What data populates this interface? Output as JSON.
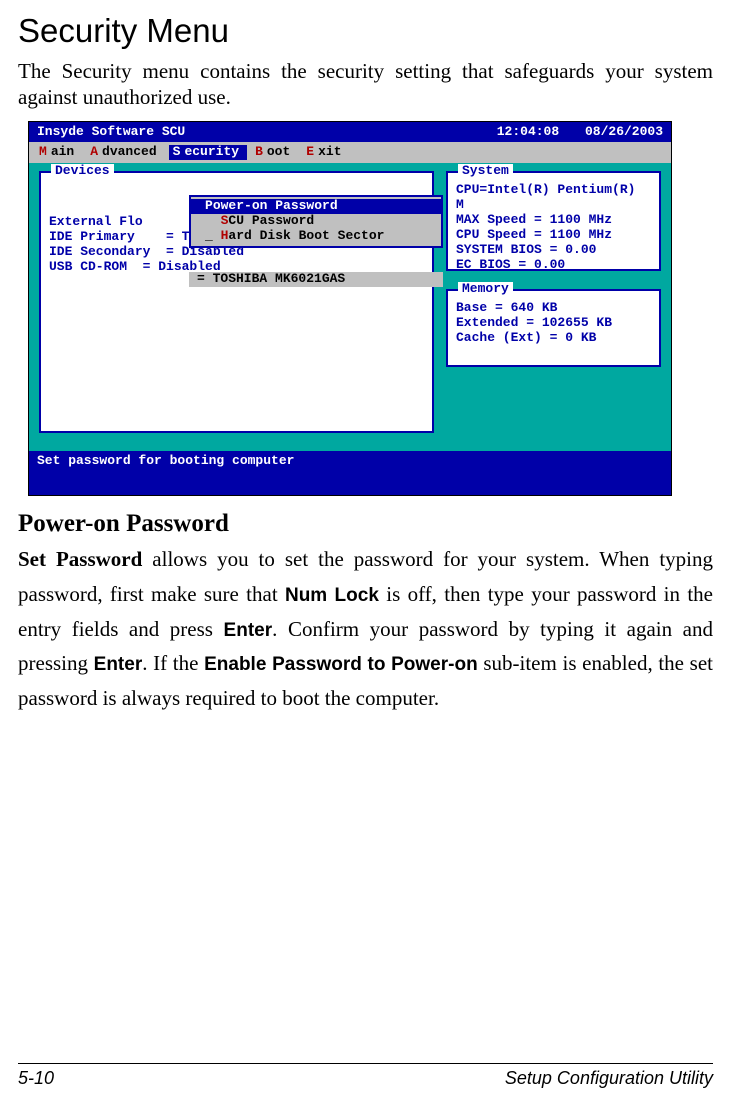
{
  "title": "Security Menu",
  "intro": "The Security menu contains the security setting that safeguards your system against unauthorized use.",
  "bios": {
    "brand": "Insyde Software SCU",
    "time": "12:04:08",
    "date": "08/26/2003",
    "menu": {
      "main": "ain",
      "advanced": "dvanced",
      "security": "ecurity",
      "boot": "oot",
      "exit": "xit"
    },
    "devices": {
      "title": "Devices",
      "lines": {
        "l1": "External Flo",
        "l2": "IDE Primary    = TOSHIBA MK6021GAS",
        "l3": "IDE Secondary  = Disabled",
        "l4": "USB CD-ROM  = Disabled"
      }
    },
    "dropdown": {
      "item1": "ower-on Password",
      "item2": "CU Password",
      "item3": "ard Disk Boot Sector",
      "overlay_row": "= TOSHIBA MK6021GAS"
    },
    "system": {
      "title": "System",
      "l1": "CPU=Intel(R) Pentium(R) M",
      "l2": "MAX   Speed = 1100 MHz",
      "l3": "CPU   Speed = 1100 MHz",
      "l4": "SYSTEM BIOS = 0.00",
      "l5": "EC     BIOS = 0.00"
    },
    "memory": {
      "title": "Memory",
      "l1": "Base         =    640 KB",
      "l2": "Extended     = 102655 KB",
      "l3": "Cache (Ext)  =      0 KB"
    },
    "help": "Set password for booting computer"
  },
  "section": {
    "heading": "Power-on Password",
    "p_strong1": "Set Password",
    "p_t1": " allows you to set the password for your system. When typing password, first make sure that ",
    "p_sans1": "Num Lock",
    "p_t2": " is off, then type your password in the entry fields and press ",
    "p_sans2": "Enter",
    "p_t3": ". Confirm your password by typing it again and pressing ",
    "p_sans3": "Enter",
    "p_t4": ". If the ",
    "p_sans4": "Enable Password to Power-on",
    "p_t5": " sub-item is enabled, the set password is always required to boot the computer."
  },
  "footer": {
    "left": "5-10",
    "right": "Setup Configuration Utility"
  }
}
